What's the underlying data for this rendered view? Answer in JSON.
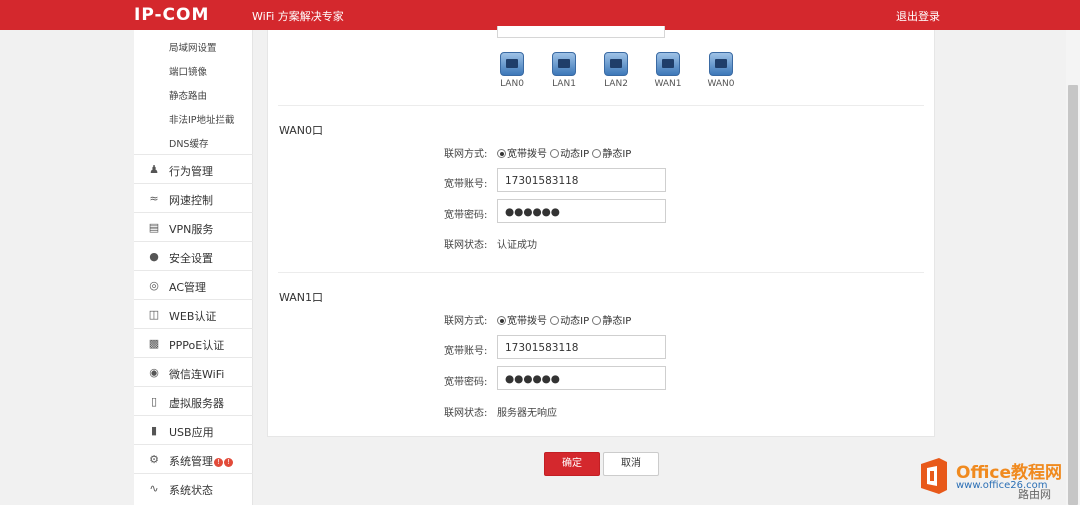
{
  "header": {
    "logo": "IP-COM",
    "slogan": "WiFi 方案解决专家",
    "logout": "退出登录"
  },
  "sidebar": {
    "sub_items": [
      "局域网设置",
      "端口镜像",
      "静态路由",
      "非法IP地址拦截",
      "DNS缓存"
    ],
    "items": [
      {
        "label": "行为管理",
        "icon": "user-icon"
      },
      {
        "label": "网速控制",
        "icon": "speed-icon"
      },
      {
        "label": "VPN服务",
        "icon": "monitor-icon"
      },
      {
        "label": "安全设置",
        "icon": "shield-icon"
      },
      {
        "label": "AC管理",
        "icon": "ac-icon"
      },
      {
        "label": "WEB认证",
        "icon": "web-icon"
      },
      {
        "label": "PPPoE认证",
        "icon": "pppoe-icon"
      },
      {
        "label": "微信连WiFi",
        "icon": "wechat-icon"
      },
      {
        "label": "虚拟服务器",
        "icon": "server-icon"
      },
      {
        "label": "USB应用",
        "icon": "usb-icon"
      },
      {
        "label": "系统管理",
        "icon": "gear-icon",
        "badges": [
          "!",
          "!"
        ]
      },
      {
        "label": "系统状态",
        "icon": "pulse-icon"
      }
    ]
  },
  "ports": [
    "LAN0",
    "LAN1",
    "LAN2",
    "WAN1",
    "WAN0"
  ],
  "labels": {
    "mode": "联网方式:",
    "account": "宽带账号:",
    "password": "宽带密码:",
    "status": "联网状态:"
  },
  "radio_options": [
    "宽带拨号",
    "动态IP",
    "静态IP"
  ],
  "wan0": {
    "title": "WAN0口",
    "account": "17301583118",
    "password": "●●●●●●",
    "status": "认证成功"
  },
  "wan1": {
    "title": "WAN1口",
    "account": "17301583118",
    "password": "●●●●●●",
    "status": "服务器无响应"
  },
  "buttons": {
    "ok": "确定",
    "cancel": "取消"
  },
  "watermark": {
    "title": "Office教程网",
    "url": "www.office26.com",
    "corner": "路由网"
  },
  "colors": {
    "brand": "#d4282d",
    "watermark_orange": "#f08a1f"
  }
}
